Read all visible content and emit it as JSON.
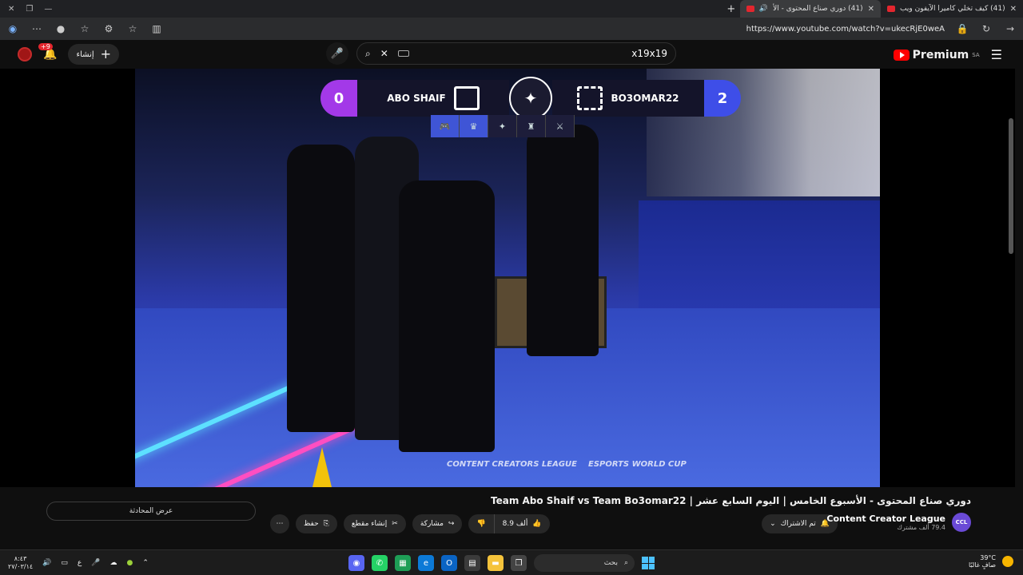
{
  "browser": {
    "tabs": [
      {
        "label": "(41) كيف تخلي كاميرا الآيفون ويب",
        "active": false
      },
      {
        "label": "(41) دوري صناع المحتوى - الأ",
        "active": true
      }
    ],
    "url": "https://www.youtube.com/watch?v=ukecRjE0weA"
  },
  "youtube": {
    "create_label": "إنشاء",
    "notification_count": "+9",
    "search_value": "x19x19",
    "premium_label": "Premium",
    "premium_region": "SA"
  },
  "video": {
    "hud": {
      "left_score": "0",
      "left_team": "ABO SHAIF",
      "right_team": "BO3OMAR22",
      "right_score": "2"
    },
    "watermark_left": "CONTENT CREATORS LEAGUE",
    "watermark_right": "ESPORTS WORLD CUP",
    "title": "دوري صناع المحتوى - الأسبوع الخامس | اليوم السابع عشر | Team Abo Shaif vs Team Bo3omar22"
  },
  "channel": {
    "name": "Content Creator League",
    "subscribers": "79.4 ألف مشترك",
    "subscribe_label": "تم الاشتراك"
  },
  "actions": {
    "likes": "8.9 ألف",
    "share": "مشاركة",
    "clip": "إنشاء مقطع",
    "save": "حفظ",
    "chat": "عرض المحادثة"
  },
  "taskbar": {
    "search_placeholder": "بحث",
    "time": "٨:٤٣",
    "date": "٢٧/٠٣/١٤",
    "lang": "ع",
    "temperature": "39°C",
    "weather_desc": "صافٍ غالبًا"
  }
}
